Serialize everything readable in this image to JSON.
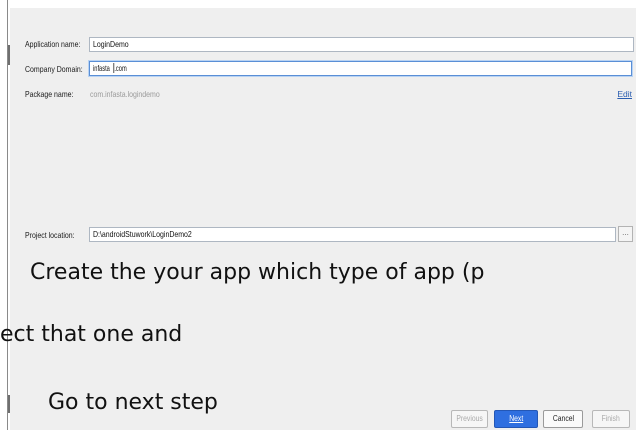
{
  "form": {
    "app_name_label": "Application name:",
    "app_name_value": "LoginDemo",
    "company_label": "Company Domain:",
    "company_value_before_caret": "infasta",
    "company_value_after_caret": ".com",
    "package_label": "Package name:",
    "package_value": "com.infasta.logindemo",
    "edit_link": "Edit",
    "location_label": "Project location:",
    "location_value": "D:\\androidStuwork\\LoginDemo2",
    "browse_label": "..."
  },
  "overlay": {
    "line1": "Create the your app which type of app (p",
    "line2": "ect that one and",
    "line3": "Go to next step"
  },
  "buttons": {
    "previous": "Previous",
    "next": "Next",
    "cancel": "Cancel",
    "finish": "Finish"
  }
}
